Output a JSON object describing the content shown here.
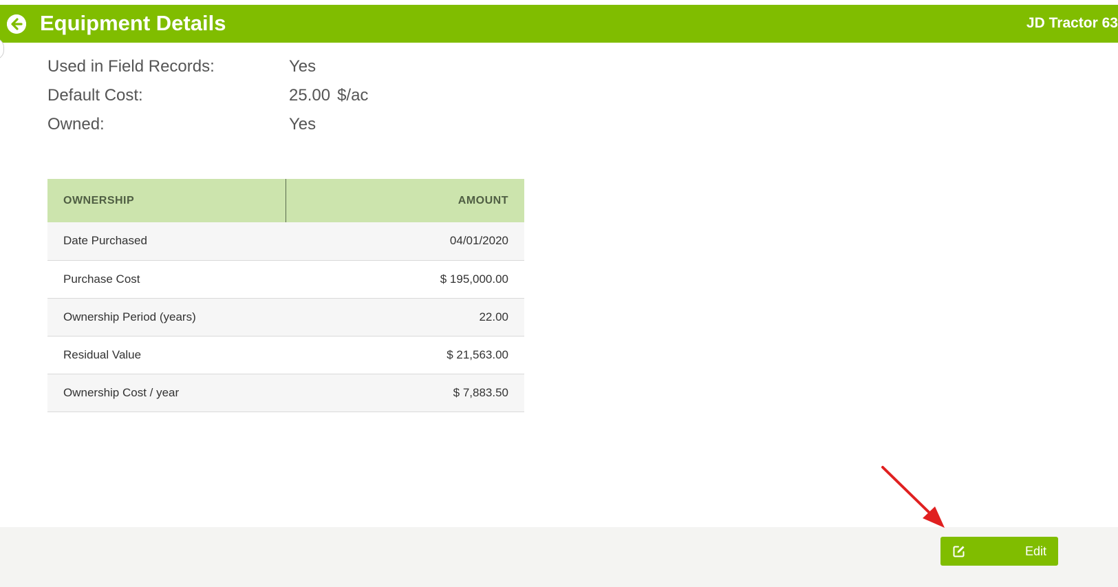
{
  "header": {
    "title": "Equipment Details",
    "equipment_name": "JD Tractor 63",
    "back_icon": "arrow-left-circle-icon",
    "background_color": "#80bd00"
  },
  "summary": {
    "used_in_field_records": {
      "label": "Used in Field Records:",
      "value": "Yes"
    },
    "default_cost": {
      "label": "Default Cost:",
      "value": "25.00",
      "unit": "$/ac"
    },
    "owned": {
      "label": "Owned:",
      "value": "Yes"
    }
  },
  "ownership_table": {
    "headers": {
      "ownership": "OWNERSHIP",
      "amount": "AMOUNT"
    },
    "header_color": "#cce4ad",
    "rows": [
      {
        "label": "Date Purchased",
        "amount": "04/01/2020"
      },
      {
        "label": "Purchase Cost",
        "amount": "$ 195,000.00"
      },
      {
        "label": "Ownership Period (years)",
        "amount": "22.00"
      },
      {
        "label": "Residual Value",
        "amount": "$ 21,563.00"
      },
      {
        "label": "Ownership Cost / year",
        "amount": "$ 7,883.50"
      }
    ]
  },
  "footer": {
    "edit_button": {
      "label": "Edit",
      "icon": "edit-icon"
    }
  },
  "annotation": {
    "arrow_color": "#e02020",
    "arrow_icon": "red-arrow-pointer"
  }
}
